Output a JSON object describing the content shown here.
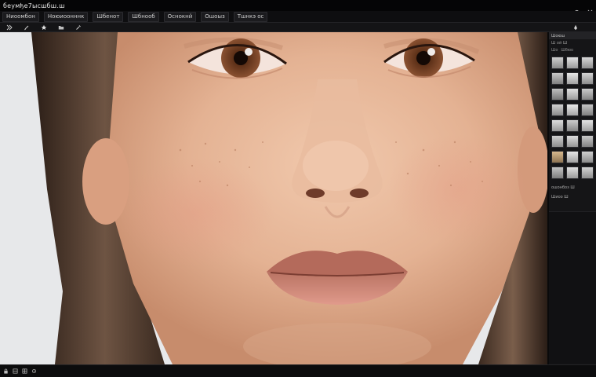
{
  "app": {
    "title": "беумђе7ысшбш.ш"
  },
  "menu": {
    "items": [
      {
        "label": "Ниоомбон"
      },
      {
        "label": "Ноюиоонннк"
      },
      {
        "label": "Шбенот"
      },
      {
        "label": "Шбнооб"
      },
      {
        "label": "Оснокнй"
      },
      {
        "label": "Ошоыз"
      },
      {
        "label": "Тшнкэ ос"
      }
    ]
  },
  "panel": {
    "header": "Шоюш",
    "subheader": "Ш ой Ш",
    "tabs": [
      "Шо",
      "Шбюо"
    ],
    "row1": "ошонбоз Ш",
    "row2": "Шиоо Ш"
  },
  "icons": {
    "close": "close-icon",
    "minimize": "minimize-icon"
  },
  "colors": {
    "background": "#0b0b0c",
    "panel": "#151517",
    "accent": "#e6e6e6"
  }
}
